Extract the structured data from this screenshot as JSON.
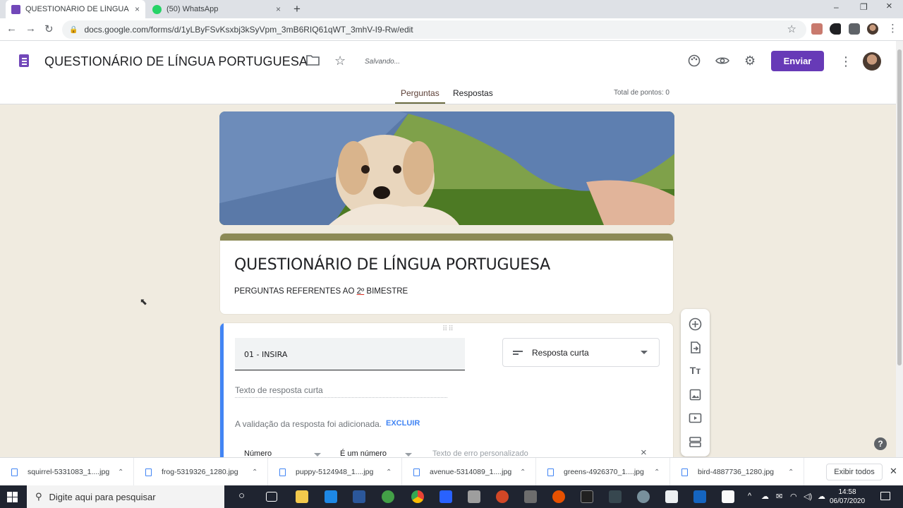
{
  "browser": {
    "tabs": [
      {
        "title": "QUESTIONÁRIO DE LÍNGUA POR",
        "close": "×"
      },
      {
        "title": "(50) WhatsApp",
        "close": "×"
      }
    ],
    "new_tab": "+",
    "window_controls": {
      "minimize": "–",
      "restore": "❐",
      "close": "×"
    },
    "url": "docs.google.com/forms/d/1yLByFSvKsxbj3kSyVpm_3mB6RIQ61qWT_3mhV-I9-Rw/edit"
  },
  "header": {
    "doc_title": "QUESTIONÁRIO DE LÍNGUA PORTUGUESA",
    "status": "Salvando...",
    "send_label": "Enviar",
    "tabs": [
      {
        "label": "Perguntas",
        "active": true
      },
      {
        "label": "Respostas",
        "active": false
      }
    ],
    "total_points": "Total de pontos: 0"
  },
  "form": {
    "title": "QUESTIONÁRIO DE LÍNGUA PORTUGUESA",
    "description_prefix": "PERGUNTAS REFERENTES AO ",
    "description_underlined": "2º",
    "description_suffix": " BIMESTRE"
  },
  "question": {
    "title": "01 - INSIRA",
    "type": "Resposta curta",
    "answer_placeholder": "Texto de resposta curta",
    "validation_text": "A validação da resposta foi adicionada.",
    "validation_remove": "EXCLUIR",
    "validation_type": "Número",
    "validation_condition": "É um número",
    "validation_error_placeholder": "Texto de erro personalizado"
  },
  "side_toolbar": [
    "add-question-icon",
    "import-questions-icon",
    "add-title-icon",
    "add-image-icon",
    "add-video-icon",
    "add-section-icon"
  ],
  "downloads": {
    "items": [
      "squirrel-5331083_1....jpg",
      "frog-5319326_1280.jpg",
      "puppy-5124948_1....jpg",
      "avenue-5314089_1....jpg",
      "greens-4926370_1....jpg",
      "bird-4887736_1280.jpg"
    ],
    "show_all": "Exibir todos"
  },
  "taskbar": {
    "search_placeholder": "Digite aqui para pesquisar",
    "time": "14:58",
    "date": "06/07/2020"
  },
  "colors": {
    "accent": "#673ab7",
    "theme_band": "#8c8a56",
    "question_accent": "#4285f4"
  }
}
